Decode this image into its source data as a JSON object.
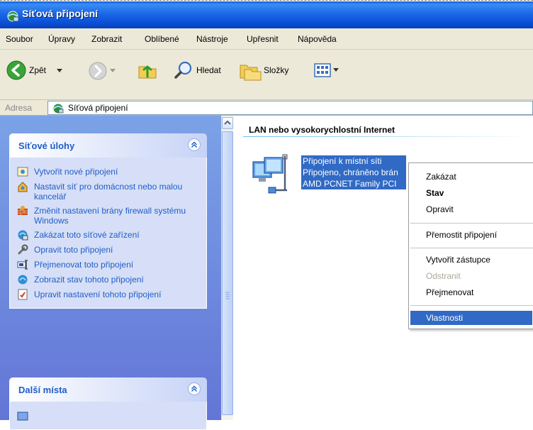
{
  "window": {
    "title": "Síťová připojení"
  },
  "menu": [
    "Soubor",
    "Úpravy",
    "Zobrazit",
    "Oblíbené",
    "Nástroje",
    "Upřesnit",
    "Nápověda"
  ],
  "toolbar": {
    "back": "Zpět",
    "search": "Hledat",
    "folders": "Složky"
  },
  "address": {
    "label": "Adresa",
    "value": "Síťová připojení"
  },
  "tasks_panel": {
    "title": "Síťové úlohy",
    "items": [
      {
        "icon": "new-connection-icon",
        "label": "Vytvořit nové připojení"
      },
      {
        "icon": "home-network-icon",
        "label": "Nastavit síť pro domácnost nebo malou kancelář"
      },
      {
        "icon": "firewall-icon",
        "label": "Změnit nastavení brány firewall systému Windows"
      },
      {
        "icon": "disable-device-icon",
        "label": "Zakázat toto síťové zařízení"
      },
      {
        "icon": "repair-icon",
        "label": "Opravit toto připojení"
      },
      {
        "icon": "rename-icon",
        "label": "Přejmenovat toto připojení"
      },
      {
        "icon": "status-icon",
        "label": "Zobrazit stav tohoto připojení"
      },
      {
        "icon": "settings-icon",
        "label": "Upravit nastavení tohoto připojení"
      }
    ]
  },
  "places_panel": {
    "title": "Další místa"
  },
  "content": {
    "group_header": "LAN nebo vysokorychlostní Internet",
    "connection": {
      "name": "Připojení k místní síti",
      "status": "Připojeno, chráněno brán",
      "device": "AMD PCNET Family PCI"
    }
  },
  "context_menu": {
    "disable": "Zakázat",
    "status": "Stav",
    "repair": "Opravit",
    "bridge": "Přemostit připojení",
    "shortcut": "Vytvořit zástupce",
    "delete": "Odstranit",
    "rename": "Přejmenovat",
    "properties": "Vlastnosti"
  },
  "colors": {
    "link": "#215dc6",
    "selection": "#316ac5",
    "title_bar": "#0a5ae0"
  }
}
